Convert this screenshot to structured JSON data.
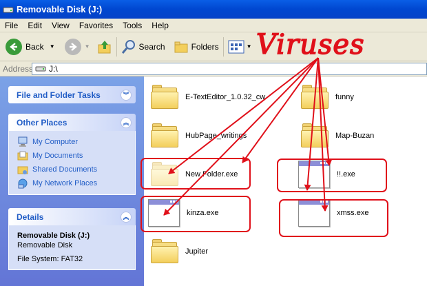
{
  "window": {
    "title": "Removable Disk (J:)"
  },
  "menu": [
    "File",
    "Edit",
    "View",
    "Favorites",
    "Tools",
    "Help"
  ],
  "toolbar": {
    "back": "Back",
    "search": "Search",
    "folders": "Folders"
  },
  "address": {
    "label": "Address",
    "value": "J:\\"
  },
  "tasks": {
    "file_folder_title": "File and Folder Tasks",
    "other_places_title": "Other Places",
    "other_places": [
      "My Computer",
      "My Documents",
      "Shared Documents",
      "My Network Places"
    ],
    "details_title": "Details",
    "details": {
      "name": "Removable Disk (J:)",
      "type": "Removable Disk",
      "fs": "File System: FAT32"
    }
  },
  "files": [
    "E-TextEditor_1.0.32_cw",
    "funny",
    "HubPage_writings",
    "Map-Buzan",
    "New Folder.exe",
    "!!.exe",
    "kinza.exe",
    "xmss.exe",
    "Jupiter"
  ],
  "annotation": {
    "text": "Viruses",
    "color": "#e0101a"
  }
}
